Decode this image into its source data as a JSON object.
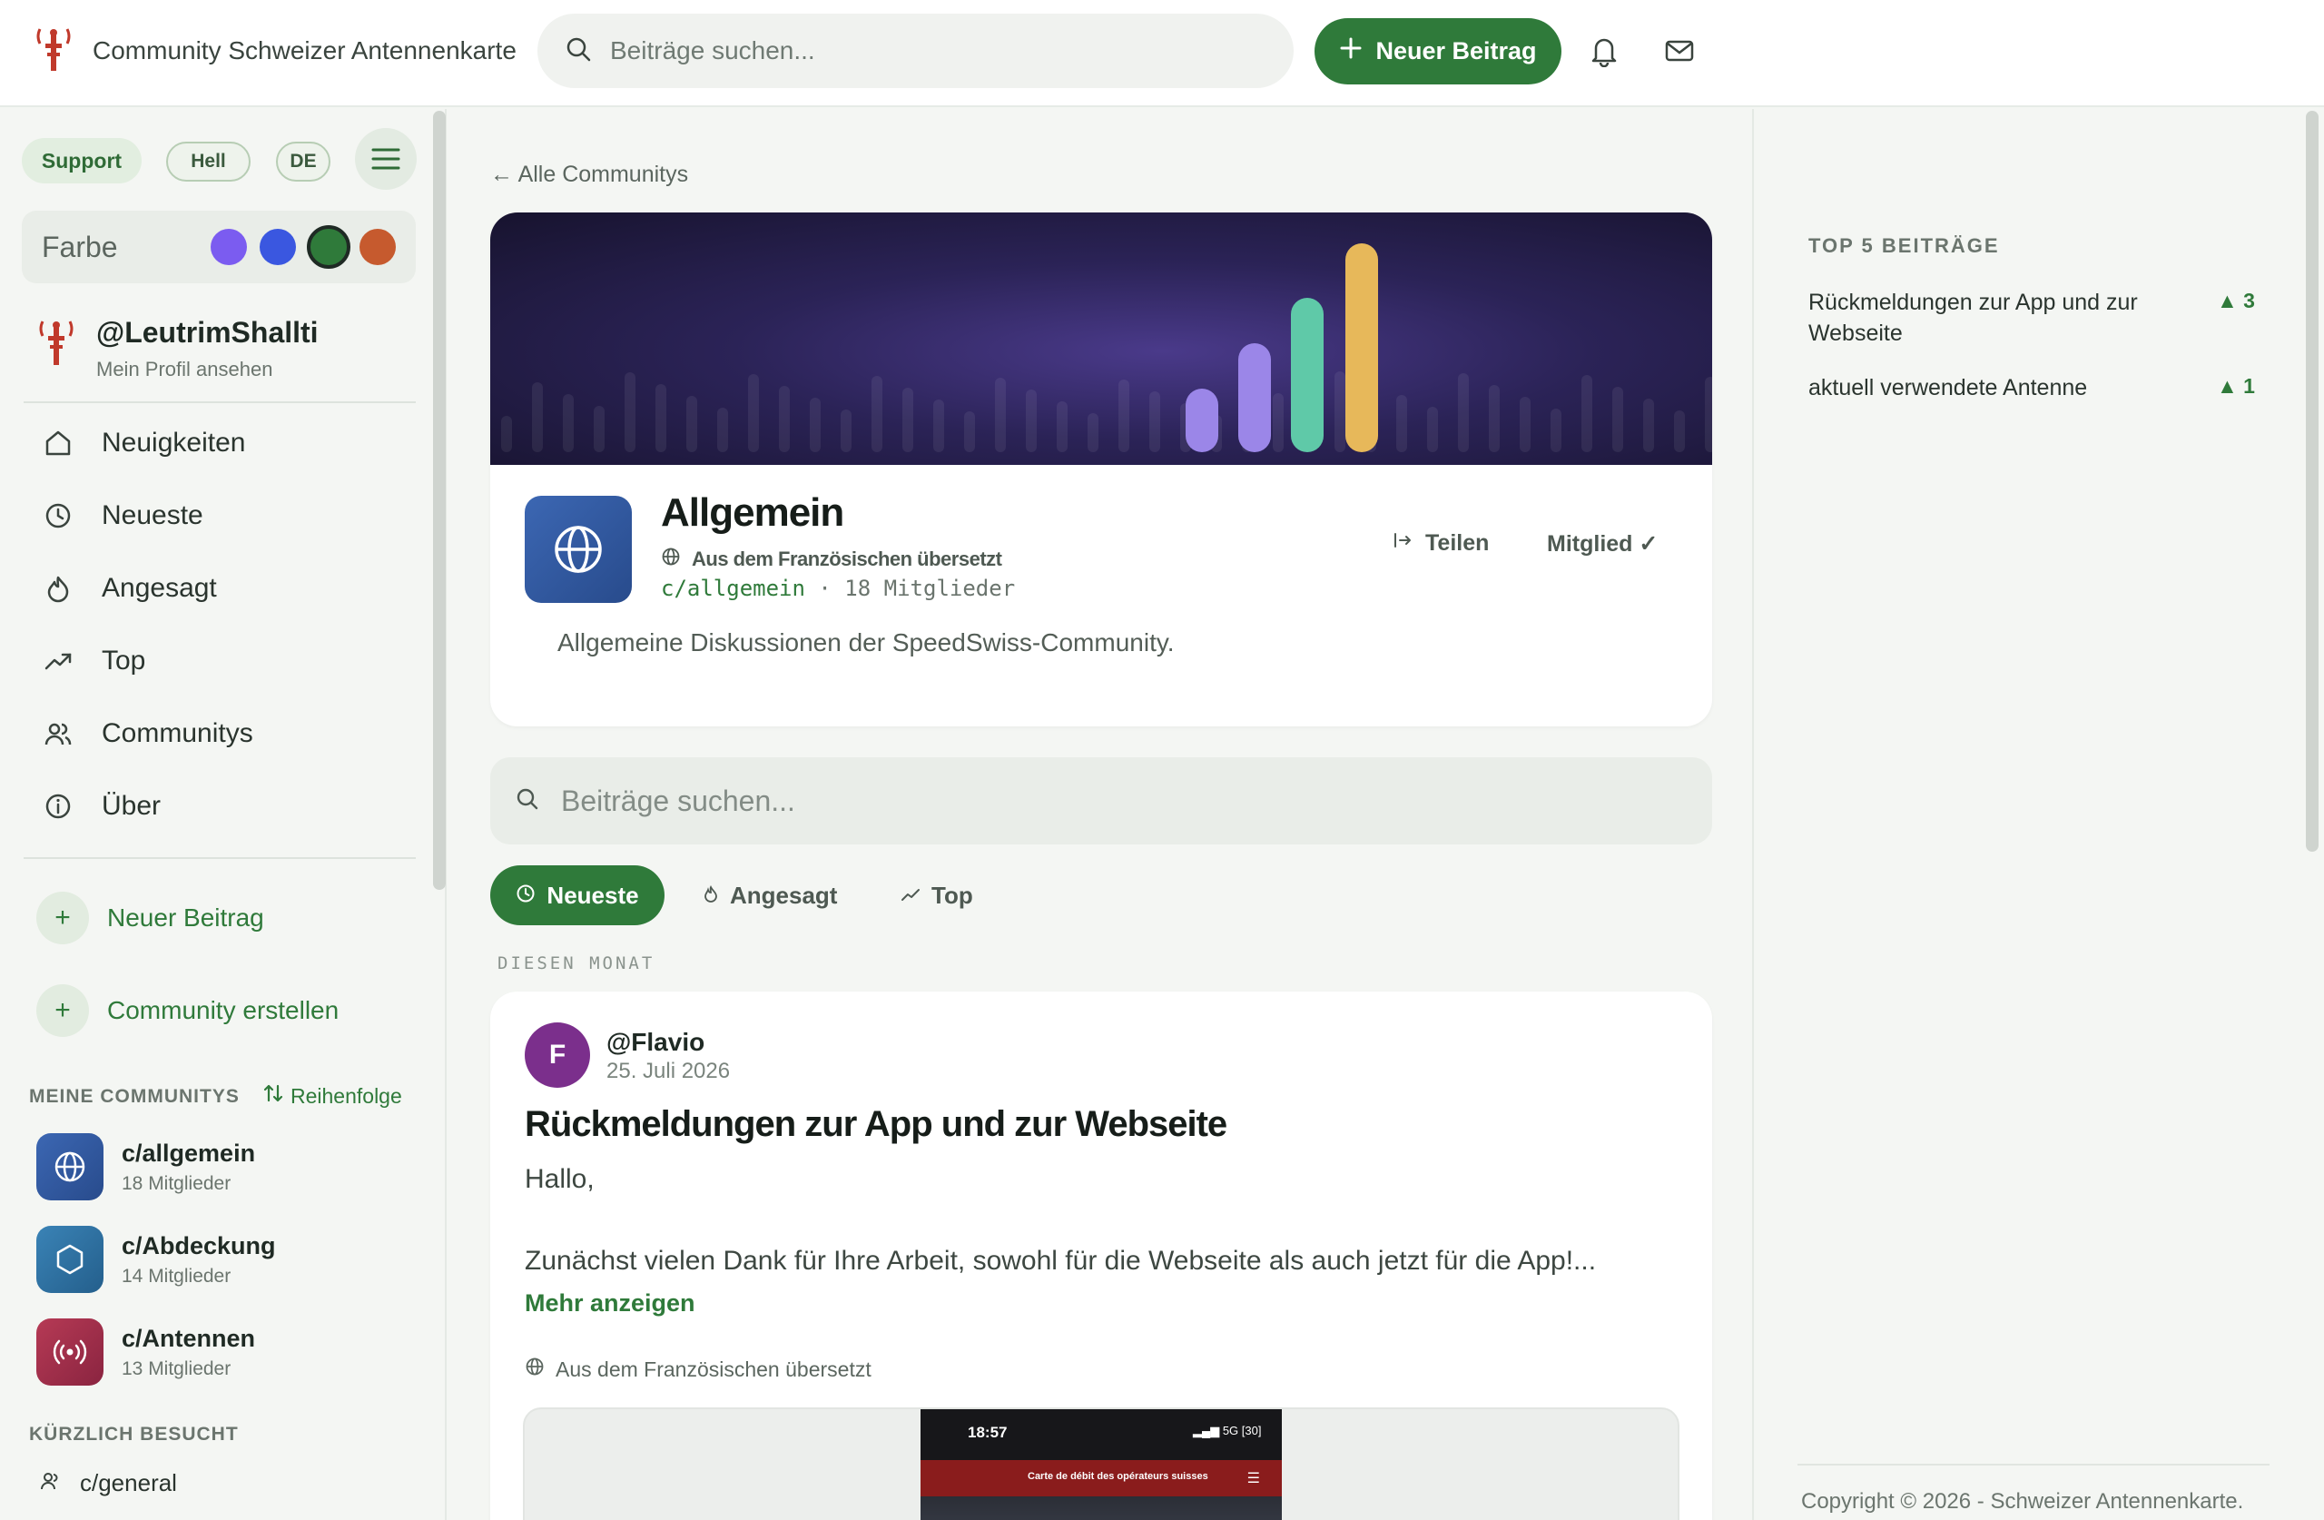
{
  "header": {
    "app_name": "Community Schweizer Antennenkarte",
    "search_placeholder": "Beiträge suchen...",
    "new_post_label": "Neuer Beitrag"
  },
  "sidebar": {
    "support_label": "Support",
    "theme_label": "Hell",
    "language_label": "DE",
    "color_label": "Farbe",
    "colors": [
      "#7b5cf0",
      "#3a57e0",
      "#2f7a3a",
      "#c65a2e"
    ],
    "profile": {
      "name": "@LeutrimShallti",
      "sub": "Mein Profil ansehen"
    },
    "nav": [
      {
        "label": "Neuigkeiten",
        "icon": "home-icon"
      },
      {
        "label": "Neueste",
        "icon": "clock-icon"
      },
      {
        "label": "Angesagt",
        "icon": "flame-icon"
      },
      {
        "label": "Top",
        "icon": "trending-up-icon"
      },
      {
        "label": "Communitys",
        "icon": "users-icon"
      },
      {
        "label": "Über",
        "icon": "info-icon"
      }
    ],
    "actions": [
      {
        "label": "Neuer Beitrag"
      },
      {
        "label": "Community erstellen"
      }
    ],
    "my_communities_title": "MEINE COMMUNITYS",
    "order_label": "Reihenfolge",
    "communities": [
      {
        "name": "c/allgemein",
        "members": "18 Mitglieder",
        "color": "#2f5aa6"
      },
      {
        "name": "c/Abdeckung",
        "members": "14 Mitglieder",
        "color": "#2f6fa0"
      },
      {
        "name": "c/Antennen",
        "members": "13 Mitglieder",
        "color": "#a3304a"
      }
    ],
    "recent_title": "KÜRZLICH BESUCHT",
    "recent": [
      {
        "name": "c/general"
      }
    ]
  },
  "main": {
    "back_label": "← Alle Communitys",
    "community": {
      "title": "Allgemein",
      "translated": "Aus dem Französischen übersetzt",
      "slug": "c/allgemein",
      "members": "· 18 Mitglieder",
      "share_label": "Teilen",
      "member_label": "Mitglied ✓",
      "description": "Allgemeine Diskussionen der SpeedSwiss-Community."
    },
    "search_placeholder": "Beiträge suchen...",
    "tabs": [
      {
        "label": "Neueste",
        "icon": "clock-icon"
      },
      {
        "label": "Angesagt",
        "icon": "flame-icon"
      },
      {
        "label": "Top",
        "icon": "trending-up-icon"
      }
    ],
    "month_label": "DIESEN MONAT",
    "post": {
      "avatar_letter": "F",
      "author": "@Flavio",
      "date": "25. Juli 2026",
      "title": "Rückmeldungen zur App und zur Webseite",
      "greeting": "Hallo,",
      "excerpt": "Zunächst vielen Dank für Ihre Arbeit, sowohl für die Webseite als auch jetzt für die App!...",
      "show_more": "Mehr anzeigen",
      "translated": "Aus dem Französischen übersetzt",
      "screenshot": {
        "time": "18:57",
        "status": "5G",
        "battery": "30",
        "bar_text": "Carte de débit des opérateurs suisses"
      }
    }
  },
  "right": {
    "top5_title": "TOP 5 BEITRÄGE",
    "top5": [
      {
        "title": "Rückmeldungen zur App und zur Webseite",
        "votes": "▲ 3"
      },
      {
        "title": "aktuell verwendete Antenne",
        "votes": "▲ 1"
      }
    ],
    "copyright": "Copyright © 2026 - Schweizer Antennenkarte."
  },
  "accent_color": "#2f7a3a"
}
